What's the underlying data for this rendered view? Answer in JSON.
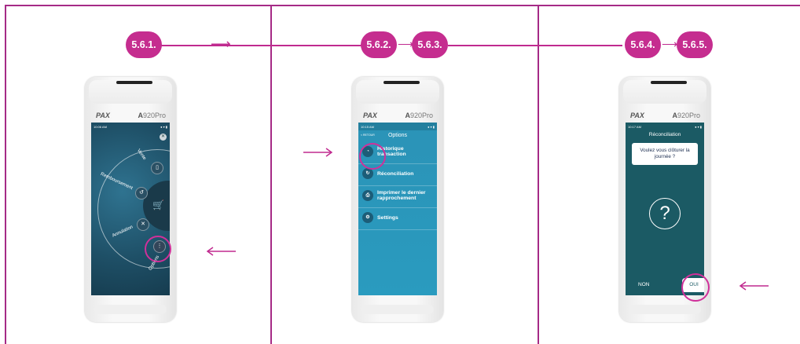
{
  "steps": {
    "s1": "5.6.1.",
    "s2": "5.6.2.",
    "s3": "5.6.3.",
    "s4": "5.6.4.",
    "s5": "5.6.5."
  },
  "device": {
    "brand": "PAX",
    "model_letter": "A",
    "model_rest": "920Pro"
  },
  "screen1": {
    "time": "10:06 AM",
    "labels": {
      "vente": "Vente",
      "remboursement": "Remboursement",
      "annulation": "Annulation",
      "options": "Options"
    }
  },
  "screen2": {
    "time": "10:15 AM",
    "back": "< RETOUR",
    "title": "Options",
    "items": [
      {
        "label": "Historique transaction"
      },
      {
        "label": "Réconciliation"
      },
      {
        "label": "Imprimer le dernier rapprochement"
      },
      {
        "label": "Settings"
      }
    ]
  },
  "screen3": {
    "time": "10:17 AM",
    "title": "Réconciliation",
    "question": "Voulez vous clôturer la journée ?",
    "icon": "?",
    "no": "NON",
    "yes": "OUI"
  },
  "colors": {
    "accent": "#c52d8f",
    "screen1_bg": "#1e4f66",
    "screen2_bg": "#2a9bbf",
    "screen3_bg": "#1b5a64"
  }
}
